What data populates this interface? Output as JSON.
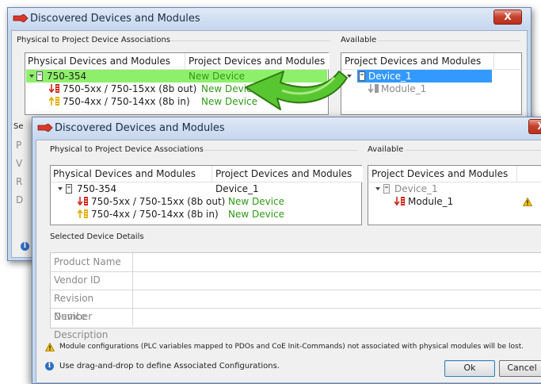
{
  "dialog_title": "Discovered Devices and Modules",
  "close_glyph": "X",
  "top": {
    "assoc_group": "Physical to Project Device Associations",
    "available_group": "Available",
    "col_physical": "Physical Devices and Modules",
    "col_project": "Project Devices and Modules",
    "physical_device": "750-354",
    "project_device": "New Device",
    "module_out": "750-5xx / 750-15xx (8b out)",
    "module_out_project": "New Device",
    "module_in": "750-4xx / 750-14xx (8b in)",
    "module_in_project": "New Device",
    "available_header": "Project Devices and Modules",
    "available_device": "Device_1",
    "available_module": "Module_1",
    "behind_fragments": [
      "Se",
      "P",
      "V",
      "R",
      "D"
    ]
  },
  "front": {
    "assoc_group": "Physical to Project Device Associations",
    "available_group": "Available",
    "col_physical": "Physical Devices and Modules",
    "col_project": "Project Devices and Modules",
    "physical_device": "750-354",
    "project_device": "Device_1",
    "module_out": "750-5xx / 750-15xx (8b out)",
    "module_out_project": "New Device",
    "module_in": "750-4xx / 750-14xx (8b in)",
    "module_in_project": "New Device",
    "available_header": "Project Devices and Modules",
    "available_device": "Device_1",
    "available_module": "Module_1",
    "details_group": "Selected Device Details",
    "details": [
      {
        "label": "Product Name",
        "value": ""
      },
      {
        "label": "Vendor ID",
        "value": ""
      },
      {
        "label": "Revision Number",
        "value": ""
      },
      {
        "label": "Device Description",
        "value": ""
      }
    ],
    "warning_text": "Module configurations (PLC variables mapped to PDOs and CoE Init-Commands) not associated with physical modules will be lost.",
    "info_text": "Use drag-and-drop to define Associated Configurations.",
    "ok_label": "Ok",
    "cancel_label": "Cancel"
  },
  "colors": {
    "selection_green": "#8ef06a",
    "selection_blue": "#3399ff",
    "arrow_green": "#58c630",
    "text_green": "#2e9a14"
  },
  "icons": [
    "close-icon",
    "device-icon",
    "module-output-icon",
    "module-input-icon",
    "expand-triangle-icon",
    "warning-icon",
    "info-icon",
    "drag-arrow-icon",
    "title-app-icon"
  ]
}
